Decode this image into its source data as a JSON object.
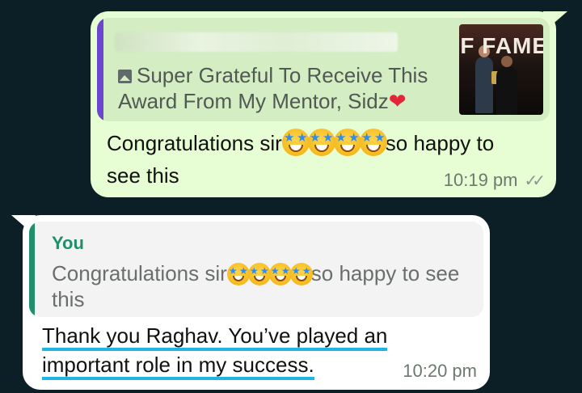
{
  "outgoing": {
    "quote": {
      "icon": "photo-icon",
      "text": "Super Grateful To Receive This Award From My Mentor, Sidz",
      "heart": "❤",
      "thumbnail_text": "F FAME"
    },
    "message_part1": "Congratulations sir",
    "message_part2": "so happy to see this",
    "time": "10:19 pm",
    "ticks": "✓✓"
  },
  "incoming": {
    "quote": {
      "author": "You",
      "text_part1": "Congratulations sir",
      "text_part2": "so happy to see this"
    },
    "line1": "Thank you Raghav. You’ve played an",
    "line2": "important role in my success.",
    "time": "10:20 pm"
  },
  "colors": {
    "outgoing_bubble": "#e7fdd3",
    "incoming_bubble": "#ffffff",
    "quote_bar_out": "#6b47d0",
    "quote_bar_in": "#1f8f6c",
    "underline": "#21b4e4"
  }
}
